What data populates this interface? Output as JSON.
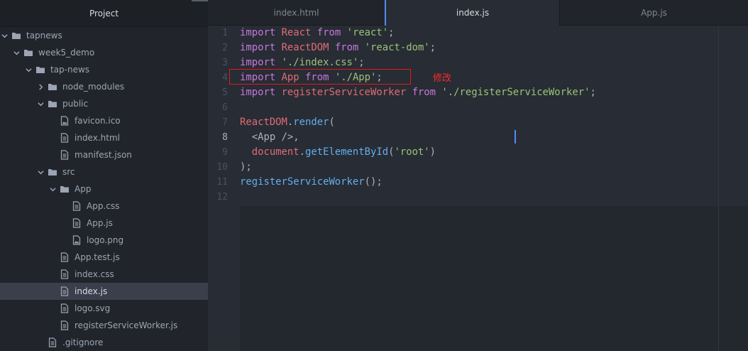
{
  "sidebar": {
    "title": "Project",
    "tree": [
      {
        "label": "tapnews",
        "type": "folder",
        "expanded": true,
        "depth": 0
      },
      {
        "label": "week5_demo",
        "type": "folder",
        "expanded": true,
        "depth": 1
      },
      {
        "label": "tap-news",
        "type": "folder",
        "expanded": true,
        "depth": 2
      },
      {
        "label": "node_modules",
        "type": "folder",
        "expanded": false,
        "depth": 3
      },
      {
        "label": "public",
        "type": "folder",
        "expanded": true,
        "depth": 3
      },
      {
        "label": "favicon.ico",
        "type": "image",
        "depth": 4
      },
      {
        "label": "index.html",
        "type": "file",
        "depth": 4
      },
      {
        "label": "manifest.json",
        "type": "file",
        "depth": 4
      },
      {
        "label": "src",
        "type": "folder",
        "expanded": true,
        "depth": 3
      },
      {
        "label": "App",
        "type": "folder",
        "expanded": true,
        "depth": 4
      },
      {
        "label": "App.css",
        "type": "file",
        "depth": 5
      },
      {
        "label": "App.js",
        "type": "file",
        "depth": 5
      },
      {
        "label": "logo.png",
        "type": "image",
        "depth": 5
      },
      {
        "label": "App.test.js",
        "type": "file",
        "depth": 4
      },
      {
        "label": "index.css",
        "type": "file",
        "depth": 4
      },
      {
        "label": "index.js",
        "type": "file",
        "depth": 4,
        "selected": true
      },
      {
        "label": "logo.svg",
        "type": "file",
        "depth": 4
      },
      {
        "label": "registerServiceWorker.js",
        "type": "file",
        "depth": 4
      },
      {
        "label": ".gitignore",
        "type": "file",
        "depth": 3
      }
    ]
  },
  "tabs": [
    {
      "label": "index.html",
      "active": false
    },
    {
      "label": "index.js",
      "active": true
    },
    {
      "label": "App.js",
      "active": false
    }
  ],
  "editor": {
    "current_line": 8,
    "lines": [
      [
        [
          "import",
          "kw"
        ],
        [
          " ",
          "plain"
        ],
        [
          "React",
          "var"
        ],
        [
          " ",
          "plain"
        ],
        [
          "from",
          "kw"
        ],
        [
          " ",
          "plain"
        ],
        [
          "'react'",
          "str"
        ],
        [
          ";",
          "plain"
        ]
      ],
      [
        [
          "import",
          "kw"
        ],
        [
          " ",
          "plain"
        ],
        [
          "ReactDOM",
          "var"
        ],
        [
          " ",
          "plain"
        ],
        [
          "from",
          "kw"
        ],
        [
          " ",
          "plain"
        ],
        [
          "'react-dom'",
          "str"
        ],
        [
          ";",
          "plain"
        ]
      ],
      [
        [
          "import",
          "kw"
        ],
        [
          " ",
          "plain"
        ],
        [
          "'./index.css'",
          "str"
        ],
        [
          ";",
          "plain"
        ]
      ],
      [
        [
          "import",
          "kw"
        ],
        [
          " ",
          "plain"
        ],
        [
          "App",
          "var"
        ],
        [
          " ",
          "plain"
        ],
        [
          "from",
          "kw"
        ],
        [
          " ",
          "plain"
        ],
        [
          "'./App'",
          "str"
        ],
        [
          ";",
          "plain"
        ]
      ],
      [
        [
          "import",
          "kw"
        ],
        [
          " ",
          "plain"
        ],
        [
          "registerServiceWorker",
          "var"
        ],
        [
          " ",
          "plain"
        ],
        [
          "from",
          "kw"
        ],
        [
          " ",
          "plain"
        ],
        [
          "'./registerServiceWorker'",
          "str"
        ],
        [
          ";",
          "plain"
        ]
      ],
      [],
      [
        [
          "ReactDOM",
          "var"
        ],
        [
          ".",
          "plain"
        ],
        [
          "render",
          "fn"
        ],
        [
          "(",
          "plain"
        ]
      ],
      [
        [
          "  <App />, ",
          "plain"
        ]
      ],
      [
        [
          "  ",
          "plain"
        ],
        [
          "document",
          "var"
        ],
        [
          ".",
          "plain"
        ],
        [
          "getElementById",
          "fn"
        ],
        [
          "(",
          "plain"
        ],
        [
          "'root'",
          "str"
        ],
        [
          ")",
          "plain"
        ]
      ],
      [
        [
          ");",
          "plain"
        ]
      ],
      [
        [
          "registerServiceWorker",
          "fn"
        ],
        [
          "();",
          "plain"
        ]
      ],
      []
    ]
  },
  "annotation": {
    "text": "修改",
    "color": "#e0191f"
  },
  "colors": {
    "keyword": "#c678dd",
    "string": "#98c379",
    "variable": "#e06c75",
    "function": "#61afef",
    "cursor": "#528bff"
  }
}
